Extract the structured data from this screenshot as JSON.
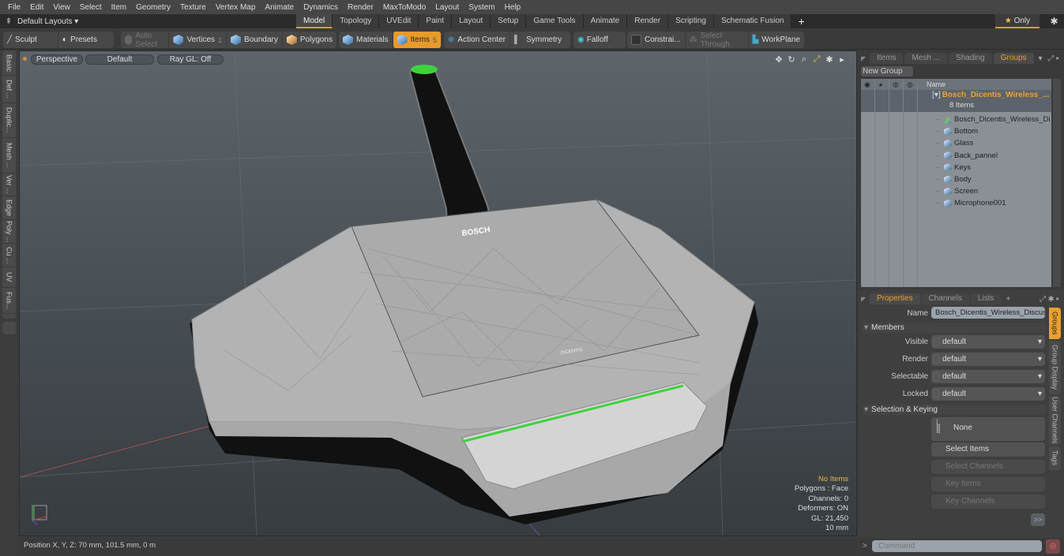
{
  "menu": [
    "File",
    "Edit",
    "View",
    "Select",
    "Item",
    "Geometry",
    "Texture",
    "Vertex Map",
    "Animate",
    "Dynamics",
    "Render",
    "MaxToModo",
    "Layout",
    "System",
    "Help"
  ],
  "layout_bar": {
    "layouts_label": "Default Layouts ▾",
    "tabs": [
      "Model",
      "Topology",
      "UVEdit",
      "Paint",
      "Layout",
      "Setup",
      "Game Tools",
      "Animate",
      "Render",
      "Scripting",
      "Schematic Fusion"
    ],
    "active_tab": "Model",
    "add_label": "+",
    "only_label": "Only"
  },
  "toolbar": {
    "sculpt": "Sculpt",
    "presets": "Presets",
    "auto_select": "Auto Select",
    "vertices": "Vertices",
    "vertices_count": "1",
    "boundary": "Boundary",
    "polygons": "Polygons",
    "materials": "Materials",
    "items": "Items",
    "items_count": "5",
    "action_center": "Action Center",
    "symmetry": "Symmetry",
    "falloff": "Falloff",
    "constraints": "Constrai...",
    "select_through": "Select Through",
    "workplane": "WorkPlane"
  },
  "left_tabs": [
    "Basic",
    "Def ...",
    "Duplic...",
    "Mesh ...",
    "Ver ...",
    "Edge",
    "Poly ...",
    "Cu ...",
    "UV",
    "Fus..."
  ],
  "viewport": {
    "view_mode": "Perspective",
    "shading": "Default",
    "raygl": "Ray GL: Off",
    "logo_text": "BOSCH",
    "sub_logo": "DICENTIS",
    "hud": {
      "selection": "No Items",
      "polygons": "Polygons : Face",
      "channels": "Channels: 0",
      "deformers": "Deformers: ON",
      "gl": "GL: 21,450",
      "grid": "10 mm"
    }
  },
  "status_bar": {
    "position": "Position X, Y, Z:   70 mm, 101.5 mm, 0 m"
  },
  "groups_panel": {
    "tabs": [
      "Items",
      "Mesh ...",
      "Shading",
      "Groups"
    ],
    "active_tab": "Groups",
    "new_group": "New Group",
    "column_name": "Name",
    "root": {
      "name": "Bosch_Dicentis_Wireless_...",
      "count": "8 Items"
    },
    "children": [
      "Bosch_Dicentis_Wireless_Di ...",
      "Bottom",
      "Glass",
      "Back_pannel",
      "Keys",
      "Body",
      "Screen",
      "Microphone001"
    ]
  },
  "properties_panel": {
    "tabs": [
      "Properties",
      "Channels",
      "Lists"
    ],
    "active_tab": "Properties",
    "name_label": "Name",
    "name_value": "Bosch_Dicentis_Wireless_Discussi",
    "members_section": "Members",
    "fields": [
      {
        "label": "Visible",
        "value": "default"
      },
      {
        "label": "Render",
        "value": "default"
      },
      {
        "label": "Selectable",
        "value": "default"
      },
      {
        "label": "Locked",
        "value": "default"
      }
    ],
    "keying_section": "Selection & Keying",
    "none_label": "None",
    "buttons": [
      "Select Items",
      "Select Channels",
      "Key Items",
      "Key Channels"
    ],
    "more": ">>",
    "side_tabs": [
      "Groups",
      "Group Display",
      "User Channels",
      "Tags"
    ],
    "command_placeholder": "Command"
  },
  "colors": {
    "accent": "#e8a030",
    "hud_highlight": "#e8b84a",
    "led_green": "#3ed33e"
  }
}
